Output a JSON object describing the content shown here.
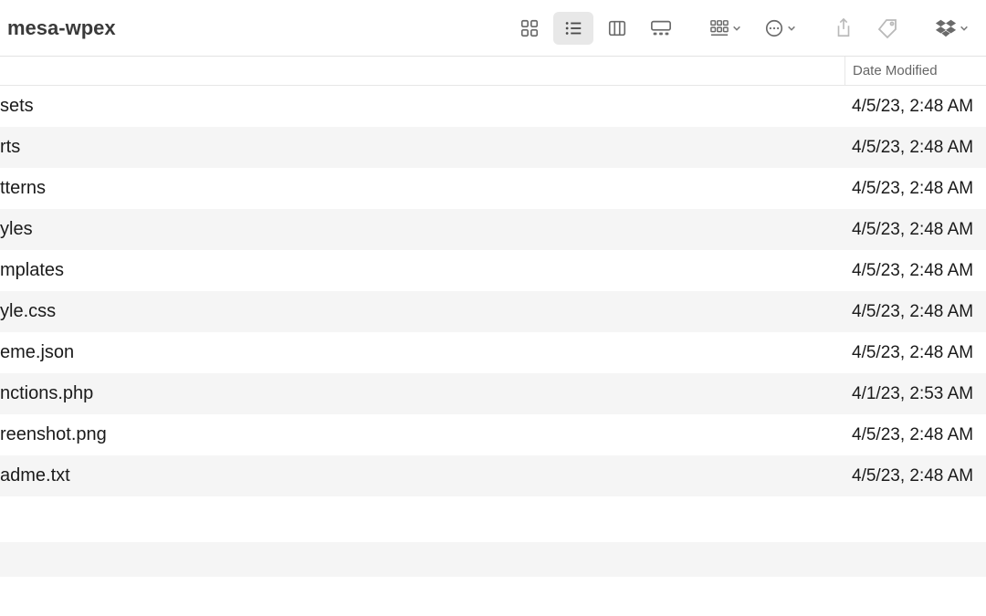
{
  "window": {
    "title": "mesa-wpex"
  },
  "columns": {
    "date_label": "Date Modified"
  },
  "files": [
    {
      "name": "sets",
      "date": "4/5/23, 2:48 AM"
    },
    {
      "name": "rts",
      "date": "4/5/23, 2:48 AM"
    },
    {
      "name": "tterns",
      "date": "4/5/23, 2:48 AM"
    },
    {
      "name": "yles",
      "date": "4/5/23, 2:48 AM"
    },
    {
      "name": "mplates",
      "date": "4/5/23, 2:48 AM"
    },
    {
      "name": "yle.css",
      "date": "4/5/23, 2:48 AM"
    },
    {
      "name": "eme.json",
      "date": "4/5/23, 2:48 AM"
    },
    {
      "name": "nctions.php",
      "date": "4/1/23, 2:53 AM"
    },
    {
      "name": "reenshot.png",
      "date": "4/5/23, 2:48 AM"
    },
    {
      "name": "adme.txt",
      "date": "4/5/23, 2:48 AM"
    }
  ]
}
